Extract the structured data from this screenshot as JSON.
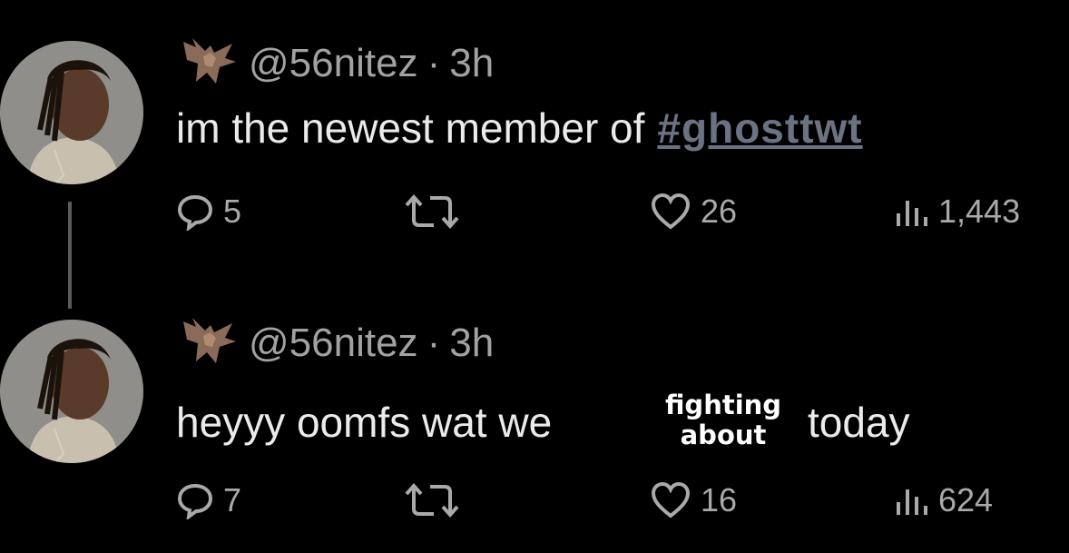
{
  "tweets": [
    {
      "handle": "@56nitez",
      "separator": "·",
      "time": "3h",
      "text": "im the newest member of",
      "hashtag": "#ghosttwt",
      "stats": {
        "replies": "5",
        "likes": "26",
        "views": "1,443"
      }
    },
    {
      "handle": "@56nitez",
      "separator": "·",
      "time": "3h",
      "text_before": "heyyy oomfs wat we",
      "inserted_line1": "fighting",
      "inserted_line2": "about",
      "text_after": "today",
      "stats": {
        "replies": "7",
        "likes": "16",
        "views": "624"
      }
    }
  ],
  "colors": {
    "background": "#000000",
    "text": "#ebebeb",
    "muted": "#a2a2a2",
    "hashtag": "#6b7282"
  },
  "icons": [
    "bat-icon",
    "reply-icon",
    "retweet-icon",
    "heart-icon",
    "views-icon"
  ]
}
